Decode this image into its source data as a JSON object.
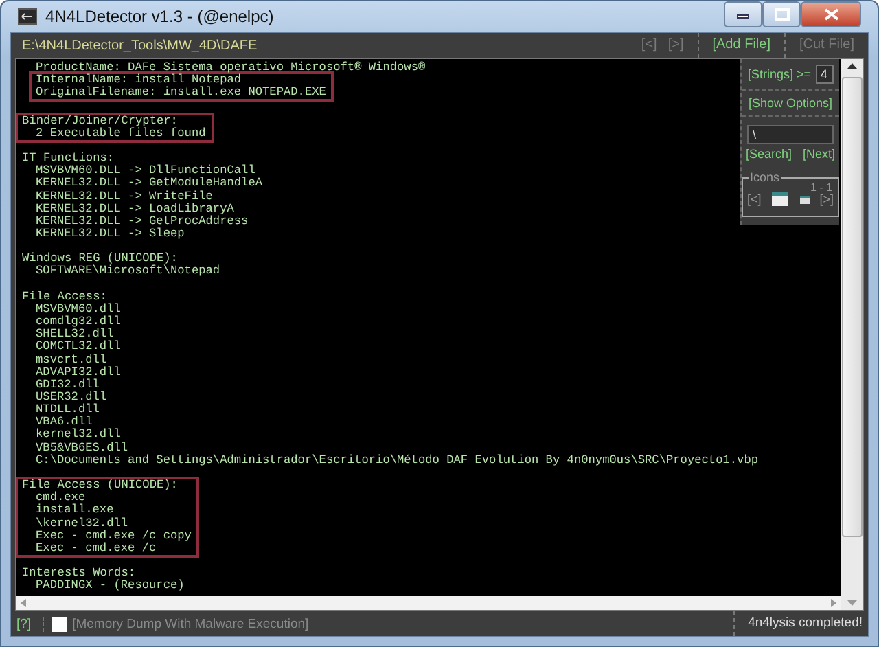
{
  "window": {
    "title": "4N4LDetector v1.3 - (@enelpc)"
  },
  "toolbar": {
    "path": "E:\\4N4LDetector_Tools\\MW_4D\\DAFE",
    "buttons": [
      {
        "label": "[<]",
        "disabled": true
      },
      {
        "label": "[>]",
        "disabled": true
      },
      {
        "label": "[Add File]",
        "disabled": false
      },
      {
        "label": "[Cut File]",
        "disabled": true
      }
    ]
  },
  "console": {
    "sections": [
      {
        "blocks": [
          {
            "highlighted": false,
            "lines": [
              {
                "kind": "item",
                "text": "ProductName: DAFe Sistema operativo Microsoft® Windows®"
              }
            ]
          },
          {
            "highlighted": true,
            "lines": [
              {
                "kind": "item",
                "text": "InternalName: install Notepad"
              },
              {
                "kind": "item",
                "text": "OriginalFilename: install.exe NOTEPAD.EXE"
              }
            ]
          }
        ]
      },
      {
        "blocks": [
          {
            "highlighted": true,
            "lines": [
              {
                "kind": "heading",
                "text": "Binder/Joiner/Crypter:"
              },
              {
                "kind": "item",
                "text": "2 Executable files found"
              }
            ]
          }
        ]
      },
      {
        "blocks": [
          {
            "highlighted": false,
            "lines": [
              {
                "kind": "heading",
                "text": "IT Functions:"
              },
              {
                "kind": "item",
                "text": "MSVBVM60.DLL -> DllFunctionCall"
              },
              {
                "kind": "item",
                "text": "KERNEL32.DLL -> GetModuleHandleA"
              },
              {
                "kind": "item",
                "text": "KERNEL32.DLL -> WriteFile"
              },
              {
                "kind": "item",
                "text": "KERNEL32.DLL -> LoadLibraryA"
              },
              {
                "kind": "item",
                "text": "KERNEL32.DLL -> GetProcAddress"
              },
              {
                "kind": "item",
                "text": "KERNEL32.DLL -> Sleep"
              }
            ]
          }
        ]
      },
      {
        "blocks": [
          {
            "highlighted": false,
            "lines": [
              {
                "kind": "heading",
                "text": "Windows REG (UNICODE):"
              },
              {
                "kind": "item",
                "text": "SOFTWARE\\Microsoft\\Notepad"
              }
            ]
          }
        ]
      },
      {
        "blocks": [
          {
            "highlighted": false,
            "lines": [
              {
                "kind": "heading",
                "text": "File Access:"
              },
              {
                "kind": "item",
                "text": "MSVBVM60.dll"
              },
              {
                "kind": "item",
                "text": "comdlg32.dll"
              },
              {
                "kind": "item",
                "text": "SHELL32.dll"
              },
              {
                "kind": "item",
                "text": "COMCTL32.dll"
              },
              {
                "kind": "item",
                "text": "msvcrt.dll"
              },
              {
                "kind": "item",
                "text": "ADVAPI32.dll"
              },
              {
                "kind": "item",
                "text": "GDI32.dll"
              },
              {
                "kind": "item",
                "text": "USER32.dll"
              },
              {
                "kind": "item",
                "text": "NTDLL.dll"
              },
              {
                "kind": "item",
                "text": "VBA6.dll"
              },
              {
                "kind": "item",
                "text": "kernel32.dll"
              },
              {
                "kind": "item",
                "text": "VB5&VB6ES.dll"
              },
              {
                "kind": "item",
                "text": "C:\\Documents and Settings\\Administrador\\Escritorio\\Método DAF Evolution By 4n0nym0us\\SRC\\Proyecto1.vbp"
              }
            ]
          }
        ]
      },
      {
        "blocks": [
          {
            "highlighted": true,
            "lines": [
              {
                "kind": "heading",
                "text": "File Access (UNICODE):"
              },
              {
                "kind": "item",
                "text": "cmd.exe"
              },
              {
                "kind": "item",
                "text": "install.exe"
              },
              {
                "kind": "item",
                "text": "\\kernel32.dll"
              },
              {
                "kind": "item",
                "text": "Exec - cmd.exe /c copy"
              },
              {
                "kind": "item",
                "text": "Exec - cmd.exe /c"
              }
            ]
          }
        ]
      },
      {
        "blocks": [
          {
            "highlighted": false,
            "lines": [
              {
                "kind": "heading",
                "text": "Interests Words:"
              },
              {
                "kind": "item",
                "text": "PADDINGX - (Resource)"
              }
            ]
          }
        ]
      }
    ]
  },
  "side_panel": {
    "strings_label": "[Strings] >=",
    "strings_value": "4",
    "show_options": "[Show Options]",
    "search_value": "\\",
    "search_button": "[Search]",
    "next_button": "[Next]",
    "icons": {
      "title": "Icons",
      "counter": "1 - 1",
      "prev": "[<]",
      "next": "[>]"
    }
  },
  "status_bar": {
    "help": "[?]",
    "memory_dump": {
      "label": "[Memory Dump With Malware Execution]",
      "checked": false,
      "disabled": true
    },
    "message": "4n4lysis completed!"
  }
}
